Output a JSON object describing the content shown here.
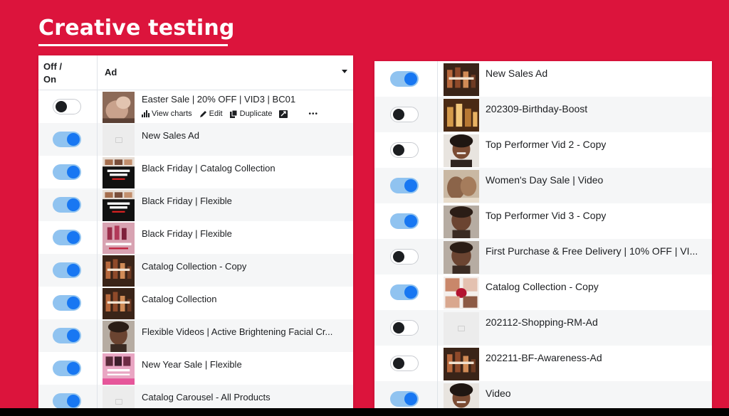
{
  "page": {
    "title": "Creative testing"
  },
  "left_table": {
    "header_off_on_line1": "Off /",
    "header_off_on_line2": "On",
    "header_ad": "Ad",
    "first_row_actions": {
      "view_charts": "View charts",
      "edit": "Edit",
      "duplicate": "Duplicate",
      "more": "•••"
    },
    "rows": [
      {
        "name": "Easter Sale | 20% OFF | VID3 | BC01",
        "on": false,
        "thumb": "face-closeup"
      },
      {
        "name": "New Sales Ad",
        "on": true,
        "thumb": "placeholder"
      },
      {
        "name": "Black Friday | Catalog Collection",
        "on": true,
        "thumb": "black-friday-sale"
      },
      {
        "name": "Black Friday | Flexible",
        "on": true,
        "thumb": "black-friday-sale"
      },
      {
        "name": "Black Friday | Flexible",
        "on": true,
        "thumb": "pink-products"
      },
      {
        "name": "Catalog Collection - Copy",
        "on": true,
        "thumb": "dark-products"
      },
      {
        "name": "Catalog Collection",
        "on": true,
        "thumb": "dark-products"
      },
      {
        "name": "Flexible Videos | Active Brightening Facial Cr...",
        "on": true,
        "thumb": "woman-face"
      },
      {
        "name": "New Year Sale | Flexible",
        "on": true,
        "thumb": "pink-promo"
      },
      {
        "name": "Catalog Carousel - All Products",
        "on": true,
        "thumb": "placeholder"
      }
    ]
  },
  "right_table": {
    "rows": [
      {
        "name": "New Sales Ad",
        "on": true,
        "thumb": "dark-products"
      },
      {
        "name": "202309-Birthday-Boost",
        "on": false,
        "thumb": "gold-bottles"
      },
      {
        "name": "Top Performer Vid 2 - Copy",
        "on": false,
        "thumb": "woman-smile"
      },
      {
        "name": "Women's Day Sale | Video",
        "on": true,
        "thumb": "beige-hands"
      },
      {
        "name": "Top Performer Vid 3 - Copy",
        "on": true,
        "thumb": "woman-face"
      },
      {
        "name": "First Purchase & Free Delivery | 10% OFF | VI...",
        "on": false,
        "thumb": "woman-face"
      },
      {
        "name": "Catalog Collection - Copy",
        "on": true,
        "thumb": "white-collage"
      },
      {
        "name": "202112-Shopping-RM-Ad",
        "on": false,
        "thumb": "placeholder"
      },
      {
        "name": "202211-BF-Awareness-Ad",
        "on": false,
        "thumb": "dark-products"
      },
      {
        "name": "Video",
        "on": true,
        "thumb": "woman-smile"
      }
    ]
  },
  "colors": {
    "background": "#dc143c",
    "toggle_on_track": "#90c3f0",
    "toggle_on_knob": "#1877f2",
    "toggle_off_knob": "#1c1e21"
  }
}
